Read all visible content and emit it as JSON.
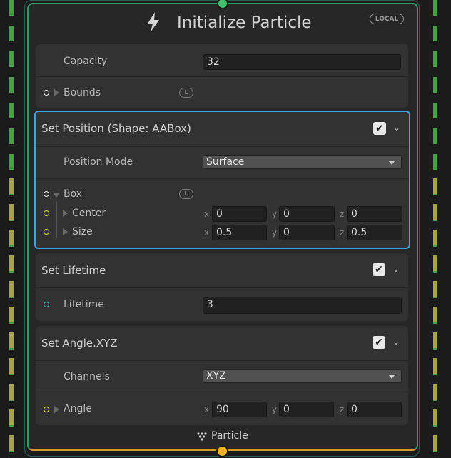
{
  "node": {
    "title": "Initialize Particle",
    "badge": "LOCAL",
    "footer_label": "Particle",
    "colors": {
      "accent_selected": "#3aa7e8",
      "flow_in": "#37c46d",
      "flow_out": "#f2b417"
    }
  },
  "properties": {
    "capacity_label": "Capacity",
    "capacity_value": "32",
    "bounds_label": "Bounds",
    "bounds_badge": "L"
  },
  "set_position": {
    "title": "Set Position (Shape: AABox)",
    "checked": true,
    "position_mode_label": "Position Mode",
    "position_mode_value": "Surface",
    "box_label": "Box",
    "box_badge": "L",
    "center_label": "Center",
    "center": {
      "x": "0",
      "y": "0",
      "z": "0"
    },
    "size_label": "Size",
    "size": {
      "x": "0.5",
      "y": "0",
      "z": "0.5"
    }
  },
  "set_lifetime": {
    "title": "Set Lifetime",
    "checked": true,
    "lifetime_label": "Lifetime",
    "lifetime_value": "3"
  },
  "set_angle": {
    "title": "Set Angle.XYZ",
    "checked": true,
    "channels_label": "Channels",
    "channels_value": "XYZ",
    "angle_label": "Angle",
    "angle": {
      "x": "90",
      "y": "0",
      "z": "0"
    }
  },
  "axis_labels": {
    "x": "x",
    "y": "y",
    "z": "z"
  },
  "icons": {
    "checkmark": "✔",
    "chevron": "⌄"
  }
}
